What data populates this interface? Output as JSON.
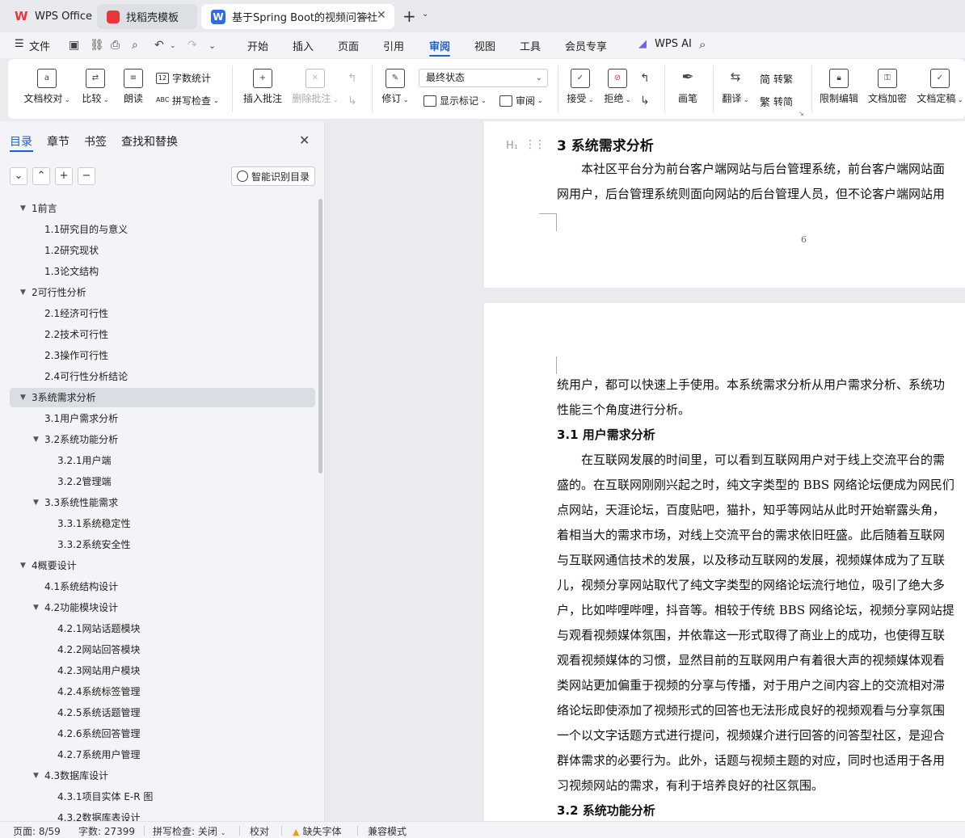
{
  "tabs": [
    {
      "label": "WPS Office"
    },
    {
      "label": "找稻壳模板"
    },
    {
      "label": "基于Spring Boot的视频问答社"
    }
  ],
  "menu": {
    "file": "文件",
    "items": [
      "开始",
      "插入",
      "页面",
      "引用",
      "审阅",
      "视图",
      "工具",
      "会员专享"
    ],
    "active": "审阅",
    "ai": "WPS AI"
  },
  "ribbon": {
    "proofread": "文档校对",
    "compare": "比较",
    "read_aloud": "朗读",
    "word_count": "字数统计",
    "spell_check": "拼写检查",
    "insert_comment": "插入批注",
    "delete_comment": "删除批注",
    "revise": "修订",
    "status_select": "最终状态",
    "show_marks": "显示标记",
    "review": "审阅",
    "accept": "接受",
    "reject": "拒绝",
    "pen": "画笔",
    "translate": "翻译",
    "to_traditional": "转繁",
    "to_simplified": "转简",
    "restrict_edit": "限制编辑",
    "encrypt": "文档加密",
    "finalize": "文档定稿"
  },
  "nav": {
    "tabs": [
      "目录",
      "章节",
      "书签",
      "查找和替换"
    ],
    "active_tab": "目录",
    "smart_toc": "智能识别目录",
    "toc": [
      {
        "label": "1前言",
        "level": 1,
        "caret": true
      },
      {
        "label": "1.1研究目的与意义",
        "level": 2
      },
      {
        "label": "1.2研究现状",
        "level": 2
      },
      {
        "label": "1.3论文结构",
        "level": 2
      },
      {
        "label": "2可行性分析",
        "level": 1,
        "caret": true
      },
      {
        "label": "2.1经济可行性",
        "level": 2
      },
      {
        "label": "2.2技术可行性",
        "level": 2
      },
      {
        "label": "2.3操作可行性",
        "level": 2
      },
      {
        "label": "2.4可行性分析结论",
        "level": 2
      },
      {
        "label": "3系统需求分析",
        "level": 1,
        "caret": true,
        "active": true
      },
      {
        "label": "3.1用户需求分析",
        "level": 2
      },
      {
        "label": "3.2系统功能分析",
        "level": 2,
        "caret": true
      },
      {
        "label": "3.2.1用户端",
        "level": 3
      },
      {
        "label": "3.2.2管理端",
        "level": 3
      },
      {
        "label": "3.3系统性能需求",
        "level": 2,
        "caret": true
      },
      {
        "label": "3.3.1系统稳定性",
        "level": 3
      },
      {
        "label": "3.3.2系统安全性",
        "level": 3
      },
      {
        "label": "4概要设计",
        "level": 1,
        "caret": true
      },
      {
        "label": "4.1系统结构设计",
        "level": 2
      },
      {
        "label": "4.2功能模块设计",
        "level": 2,
        "caret": true
      },
      {
        "label": "4.2.1网站话题模块",
        "level": 3
      },
      {
        "label": "4.2.2网站回答模块",
        "level": 3
      },
      {
        "label": "4.2.3网站用户模块",
        "level": 3
      },
      {
        "label": "4.2.4系统标签管理",
        "level": 3
      },
      {
        "label": "4.2.5系统话题管理",
        "level": 3
      },
      {
        "label": "4.2.6系统回答管理",
        "level": 3
      },
      {
        "label": "4.2.7系统用户管理",
        "level": 3
      },
      {
        "label": "4.3数据库设计",
        "level": 2,
        "caret": true
      },
      {
        "label": "4.3.1项目实体 E-R 图",
        "level": 3
      },
      {
        "label": "4.3.2数据库表设计",
        "level": 3
      }
    ]
  },
  "document": {
    "page1": {
      "heading": "3  系统需求分析",
      "lines": [
        "本社区平台分为前台客户端网站与后台管理系统，前台客户端网站面",
        "网用户，后台管理系统则面向网站的后台管理人员，但不论客户端网站用"
      ],
      "page_number": "6"
    },
    "page2": {
      "lines": [
        {
          "text": "统用户，都可以快速上手使用。本系统需求分析从用户需求分析、系统功",
          "type": "p"
        },
        {
          "text": "性能三个角度进行分析。",
          "type": "p"
        },
        {
          "text": "3.1  用户需求分析",
          "type": "h2"
        },
        {
          "text": "在互联网发展的时间里，可以看到互联网用户对于线上交流平台的需",
          "type": "indent"
        },
        {
          "text": "盛的。在互联网刚刚兴起之时，纯文字类型的 BBS 网络论坛便成为网民们",
          "type": "p"
        },
        {
          "text": "点网站，天涯论坛，百度贴吧，猫扑，知乎等网站从此时开始崭露头角，",
          "type": "p"
        },
        {
          "text": "着相当大的需求市场，对线上交流平台的需求依旧旺盛。此后随着互联网",
          "type": "p"
        },
        {
          "text": "与互联网通信技术的发展，以及移动互联网的发展，视频媒体成为了互联",
          "type": "p"
        },
        {
          "text": "儿，视频分享网站取代了纯文字类型的网络论坛流行地位，吸引了绝大多",
          "type": "p"
        },
        {
          "text": "户，比如哔哩哔哩，抖音等。相较于传统 BBS 网络论坛，视频分享网站提",
          "type": "p"
        },
        {
          "text": "与观看视频媒体氛围，并依靠这一形式取得了商业上的成功，也使得互联",
          "type": "p"
        },
        {
          "text": "观看视频媒体的习惯，显然目前的互联网用户有着很大声的视频媒体观看",
          "type": "p"
        },
        {
          "text": "类网站更加偏重于视频的分享与传播，对于用户之间内容上的交流相对滞",
          "type": "p"
        },
        {
          "text": "络论坛即使添加了视频形式的回答也无法形成良好的视频观看与分享氛围",
          "type": "p"
        },
        {
          "text": "一个以文字话题方式进行提问，视频媒介进行回答的问答型社区，是迎合",
          "type": "p"
        },
        {
          "text": "群体需求的必要行为。此外，话题与视频主题的对应，同时也适用于各用",
          "type": "p"
        },
        {
          "text": "习视频网站的需求，有利于培养良好的社区氛围。",
          "type": "p"
        },
        {
          "text": "3.2  系统功能分析",
          "type": "h2"
        }
      ]
    }
  },
  "statusbar": {
    "page": "页面: 8/59",
    "words": "字数: 27399",
    "spell": "拼写检查: 关闭",
    "proof": "校对",
    "missing_font": "缺失字体",
    "compat": "兼容模式"
  }
}
